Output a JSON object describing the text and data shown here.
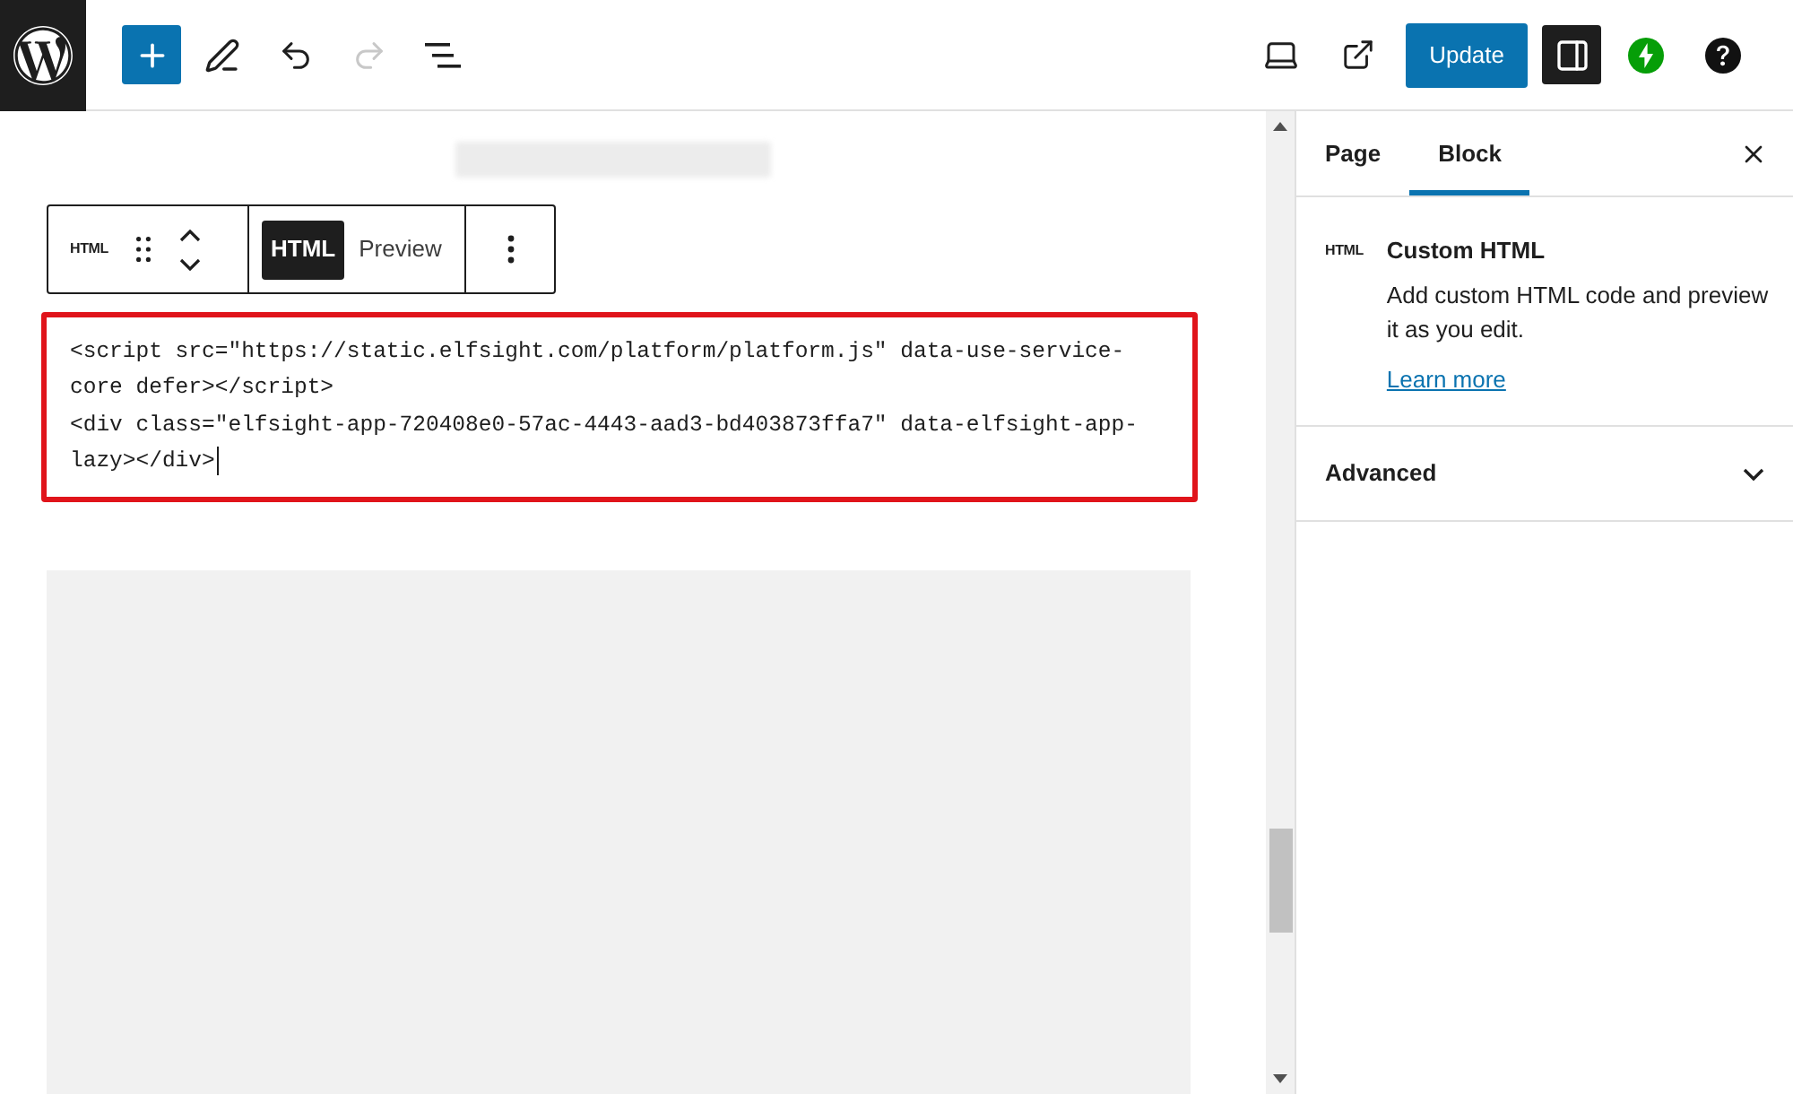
{
  "header": {
    "history": [
      {
        "kind": "undo",
        "disabled": false
      },
      {
        "kind": "redo",
        "disabled": true
      }
    ],
    "update_button": "Update",
    "sidebar_toggle": {
      "on": true
    }
  },
  "editor": {
    "block_toolbar": {
      "block_icon": "HTML",
      "modes": [
        {
          "label": "HTML",
          "selected": true
        },
        {
          "label": "Preview",
          "selected": false
        }
      ]
    },
    "code_editor": {
      "highlighted": true,
      "lines": [
        "<script src=\"https://static.elfsight.com/platform/platform.js\" data-use-service-",
        "core defer></script>",
        "<div class=\"elfsight-app-720408e0-57ac-4443-aad3-bd403873ffa7\" data-elfsight-app-",
        "lazy></div>"
      ]
    }
  },
  "sidebar": {
    "tabs": [
      {
        "label": "Page",
        "selected": false
      },
      {
        "label": "Block",
        "selected": true
      }
    ],
    "block_card": {
      "icon": "HTML",
      "title": "Custom HTML",
      "description": "Add custom HTML code and preview it as you edit.",
      "link": "Learn more"
    },
    "panels": [
      {
        "title": "Advanced",
        "expanded": false
      }
    ]
  }
}
